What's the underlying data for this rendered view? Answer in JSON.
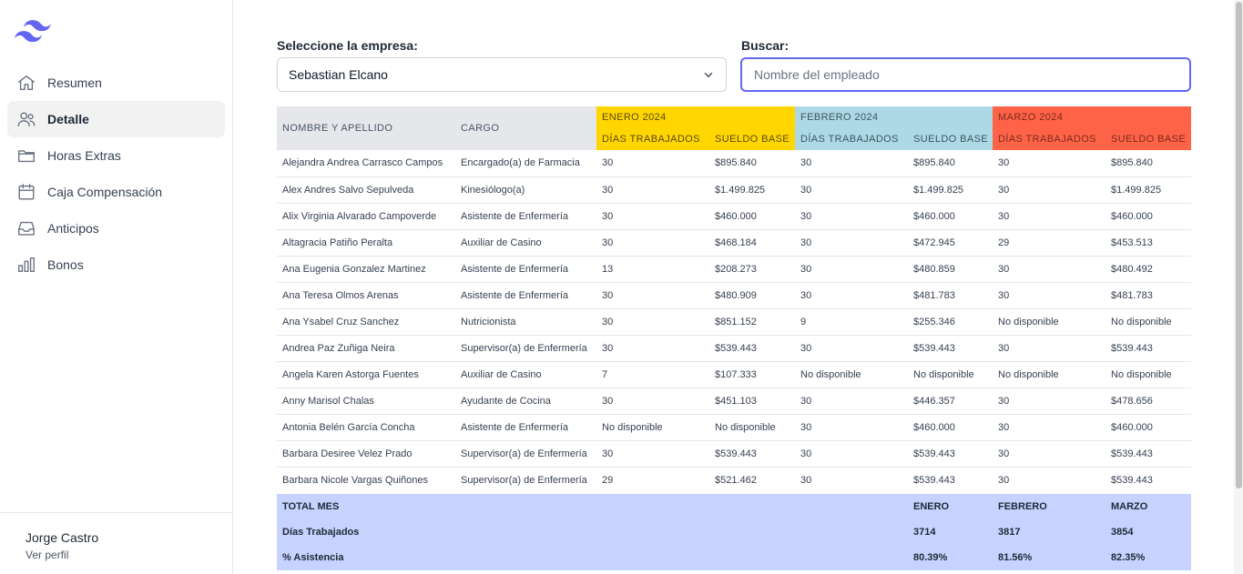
{
  "sidebar": {
    "logo_icon": "tailwind-wave-logo",
    "items": [
      {
        "label": "Resumen",
        "icon": "home-icon"
      },
      {
        "label": "Detalle",
        "icon": "users-icon",
        "active": true
      },
      {
        "label": "Horas Extras",
        "icon": "folder-icon"
      },
      {
        "label": "Caja Compensación",
        "icon": "calendar-icon"
      },
      {
        "label": "Anticipos",
        "icon": "inbox-icon"
      },
      {
        "label": "Bonos",
        "icon": "chart-bar-icon"
      }
    ],
    "user": {
      "name": "Jorge Castro",
      "link": "Ver perfil"
    }
  },
  "filters": {
    "company_label": "Seleccione la empresa:",
    "company_value": "Sebastian Elcano",
    "search_label": "Buscar:",
    "search_placeholder": "Nombre del empleado",
    "search_value": ""
  },
  "table": {
    "col_name": "NOMBRE Y APELLIDO",
    "col_role": "CARGO",
    "months": [
      "ENERO 2024",
      "FEBRERO 2024",
      "MARZO 2024"
    ],
    "month_colors": [
      "#ffd600",
      "#add8e6",
      "#ff6347"
    ],
    "sub_days": "DÍAS TRABAJADOS",
    "sub_salary": "SUELDO BASE",
    "rows": [
      [
        "Alejandra Andrea Carrasco Campos",
        "Encargado(a) de Farmacia",
        "30",
        "$895.840",
        "30",
        "$895.840",
        "30",
        "$895.840"
      ],
      [
        "Alex Andres Salvo Sepulveda",
        "Kinesiólogo(a)",
        "30",
        "$1.499.825",
        "30",
        "$1.499.825",
        "30",
        "$1.499.825"
      ],
      [
        "Alix Virginia Alvarado Campoverde",
        "Asistente de Enfermería",
        "30",
        "$460.000",
        "30",
        "$460.000",
        "30",
        "$460.000"
      ],
      [
        "Altagracia Patiño Peralta",
        "Auxiliar de Casino",
        "30",
        "$468.184",
        "30",
        "$472.945",
        "29",
        "$453.513"
      ],
      [
        "Ana Eugenia Gonzalez Martinez",
        "Asistente de Enfermería",
        "13",
        "$208.273",
        "30",
        "$480.859",
        "30",
        "$480.492"
      ],
      [
        "Ana Teresa Olmos Arenas",
        "Asistente de Enfermería",
        "30",
        "$480.909",
        "30",
        "$481.783",
        "30",
        "$481.783"
      ],
      [
        "Ana Ysabel Cruz Sanchez",
        "Nutricionista",
        "30",
        "$851.152",
        "9",
        "$255.346",
        "No disponible",
        "No disponible"
      ],
      [
        "Andrea Paz Zuñiga Neira",
        "Supervisor(a) de Enfermería",
        "30",
        "$539.443",
        "30",
        "$539.443",
        "30",
        "$539.443"
      ],
      [
        "Angela Karen Astorga Fuentes",
        "Auxiliar de Casino",
        "7",
        "$107.333",
        "No disponible",
        "No disponible",
        "No disponible",
        "No disponible"
      ],
      [
        "Anny Marisol Chalas",
        "Ayudante de Cocina",
        "30",
        "$451.103",
        "30",
        "$446.357",
        "30",
        "$478.656"
      ],
      [
        "Antonia Belén García Concha",
        "Asistente de Enfermería",
        "No disponible",
        "No disponible",
        "30",
        "$460.000",
        "30",
        "$460.000"
      ],
      [
        "Barbara Desiree Velez Prado",
        "Supervisor(a) de Enfermería",
        "30",
        "$539.443",
        "30",
        "$539.443",
        "30",
        "$539.443"
      ],
      [
        "Barbara Nicole Vargas Quiñones",
        "Supervisor(a) de Enfermería",
        "29",
        "$521.462",
        "30",
        "$539.443",
        "30",
        "$539.443"
      ]
    ]
  },
  "totals": {
    "title": "TOTAL MES",
    "months": [
      "ENERO",
      "FEBRERO",
      "MARZO"
    ],
    "days_label": "Días Trabajados",
    "days": [
      "3714",
      "3817",
      "3854"
    ],
    "attendance_label": "% Asistencia",
    "attendance": [
      "80.39%",
      "81.56%",
      "82.35%"
    ],
    "color": "#c7d2fe"
  }
}
